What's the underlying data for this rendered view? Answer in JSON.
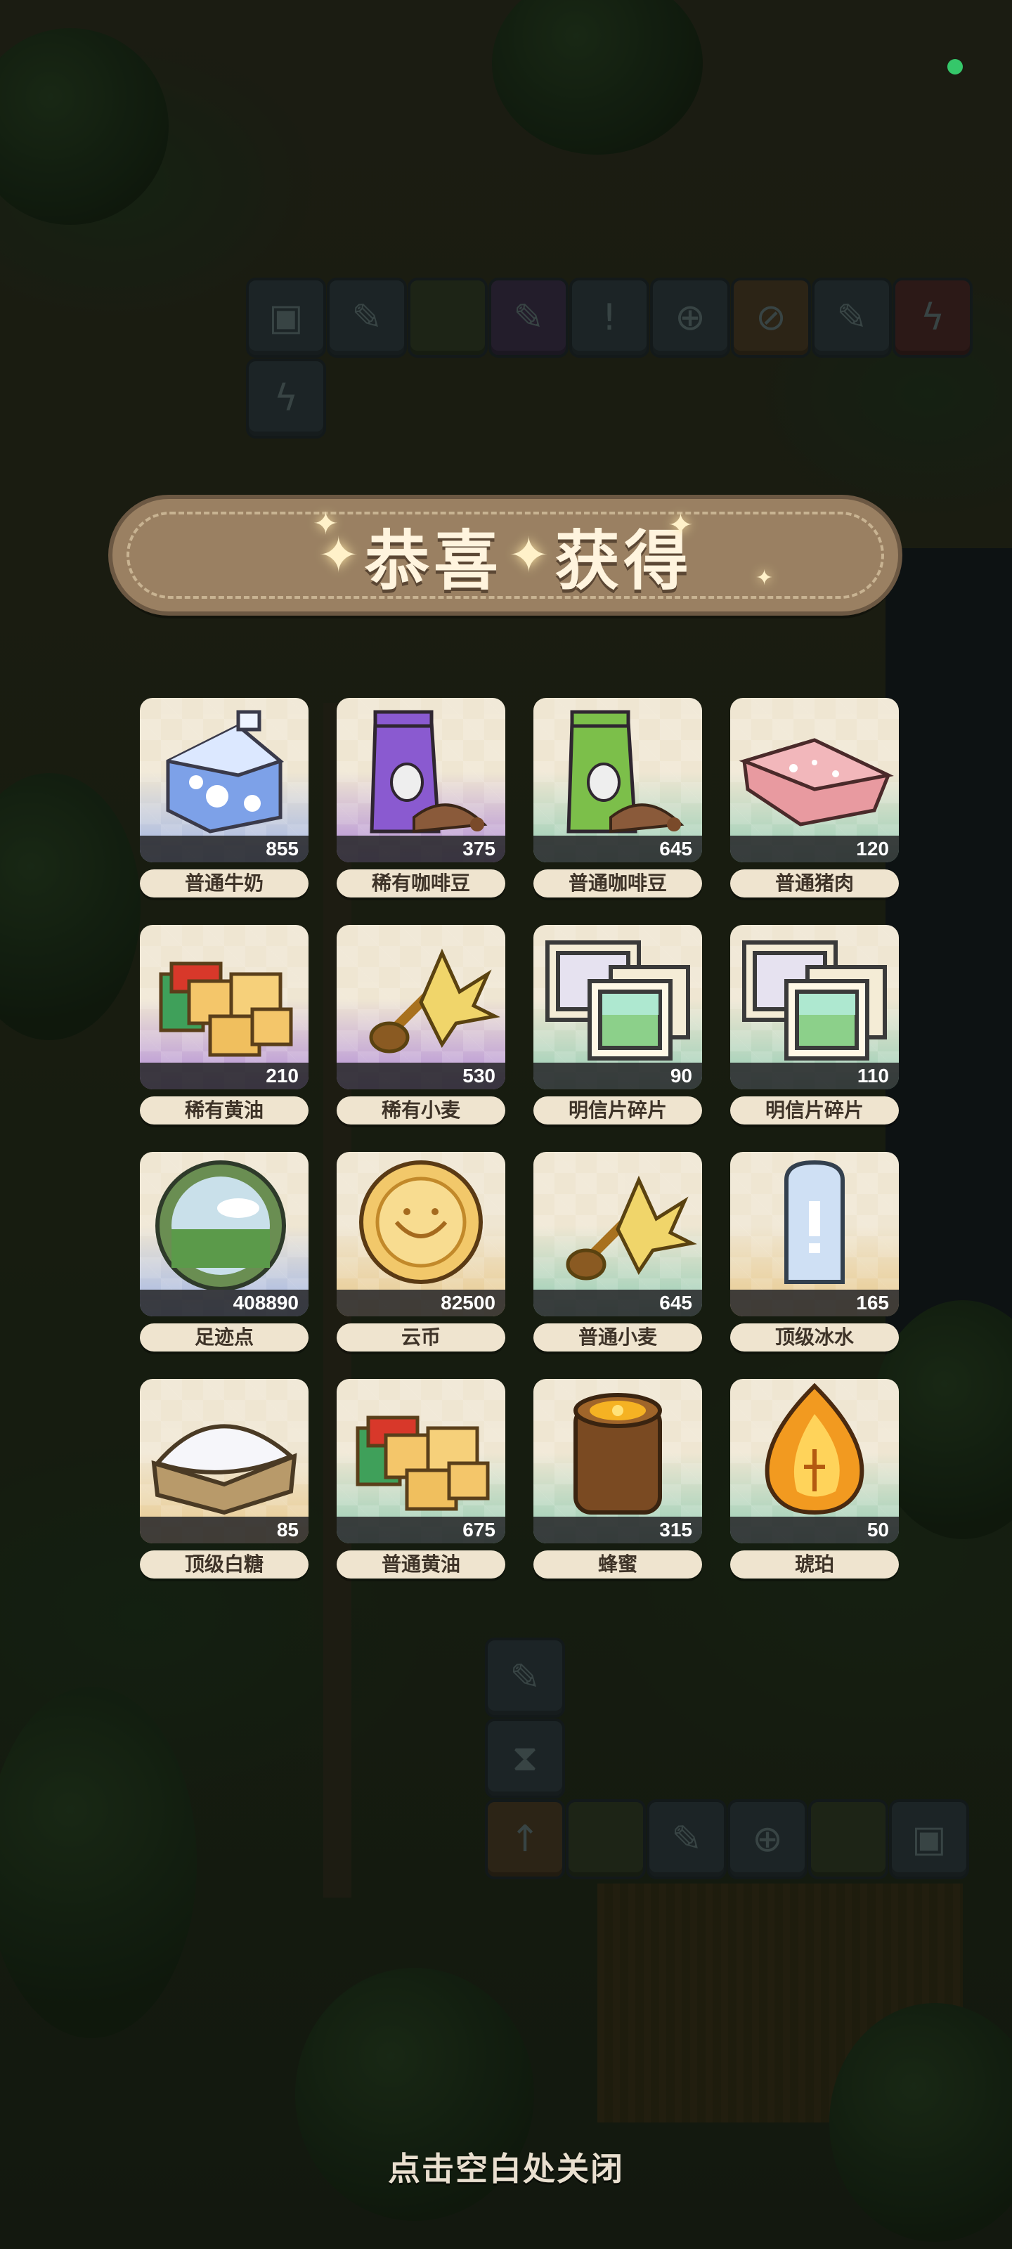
{
  "banner": {
    "title_left": "恭喜",
    "title_right": "获得"
  },
  "rewards": [
    {
      "name": "普通牛奶",
      "quantity": "855",
      "icon": "milk-carton-icon",
      "bg": "blue"
    },
    {
      "name": "稀有咖啡豆",
      "quantity": "375",
      "icon": "coffee-bag-icon",
      "bg": "purple"
    },
    {
      "name": "普通咖啡豆",
      "quantity": "645",
      "icon": "coffee-bag-icon",
      "bg": "green"
    },
    {
      "name": "普通猪肉",
      "quantity": "120",
      "icon": "pork-icon",
      "bg": "green"
    },
    {
      "name": "稀有黄油",
      "quantity": "210",
      "icon": "butter-icon",
      "bg": "purple"
    },
    {
      "name": "稀有小麦",
      "quantity": "530",
      "icon": "wheat-icon",
      "bg": "purple"
    },
    {
      "name": "明信片碎片",
      "quantity": "90",
      "icon": "postcard-icon",
      "bg": "green"
    },
    {
      "name": "明信片碎片",
      "quantity": "110",
      "icon": "postcard-icon",
      "bg": "green"
    },
    {
      "name": "足迹点",
      "quantity": "408890",
      "icon": "footprint-orb-icon",
      "bg": "blue"
    },
    {
      "name": "云币",
      "quantity": "82500",
      "icon": "cloud-coin-icon",
      "bg": "gold"
    },
    {
      "name": "普通小麦",
      "quantity": "645",
      "icon": "wheat-icon",
      "bg": "green"
    },
    {
      "name": "顶级冰水",
      "quantity": "165",
      "icon": "ice-water-icon",
      "bg": "gold"
    },
    {
      "name": "顶级白糖",
      "quantity": "85",
      "icon": "sugar-icon",
      "bg": "gold"
    },
    {
      "name": "普通黄油",
      "quantity": "675",
      "icon": "butter-icon",
      "bg": "green"
    },
    {
      "name": "蜂蜜",
      "quantity": "315",
      "icon": "honey-jar-icon",
      "bg": "green"
    },
    {
      "name": "琥珀",
      "quantity": "50",
      "icon": "amber-icon",
      "bg": "green"
    }
  ],
  "footer": {
    "close_hint": "点击空白处关闭"
  },
  "colors": {
    "banner": "#9a8062",
    "pill": "#efe4cf",
    "quantity_bar": "#28282a"
  }
}
